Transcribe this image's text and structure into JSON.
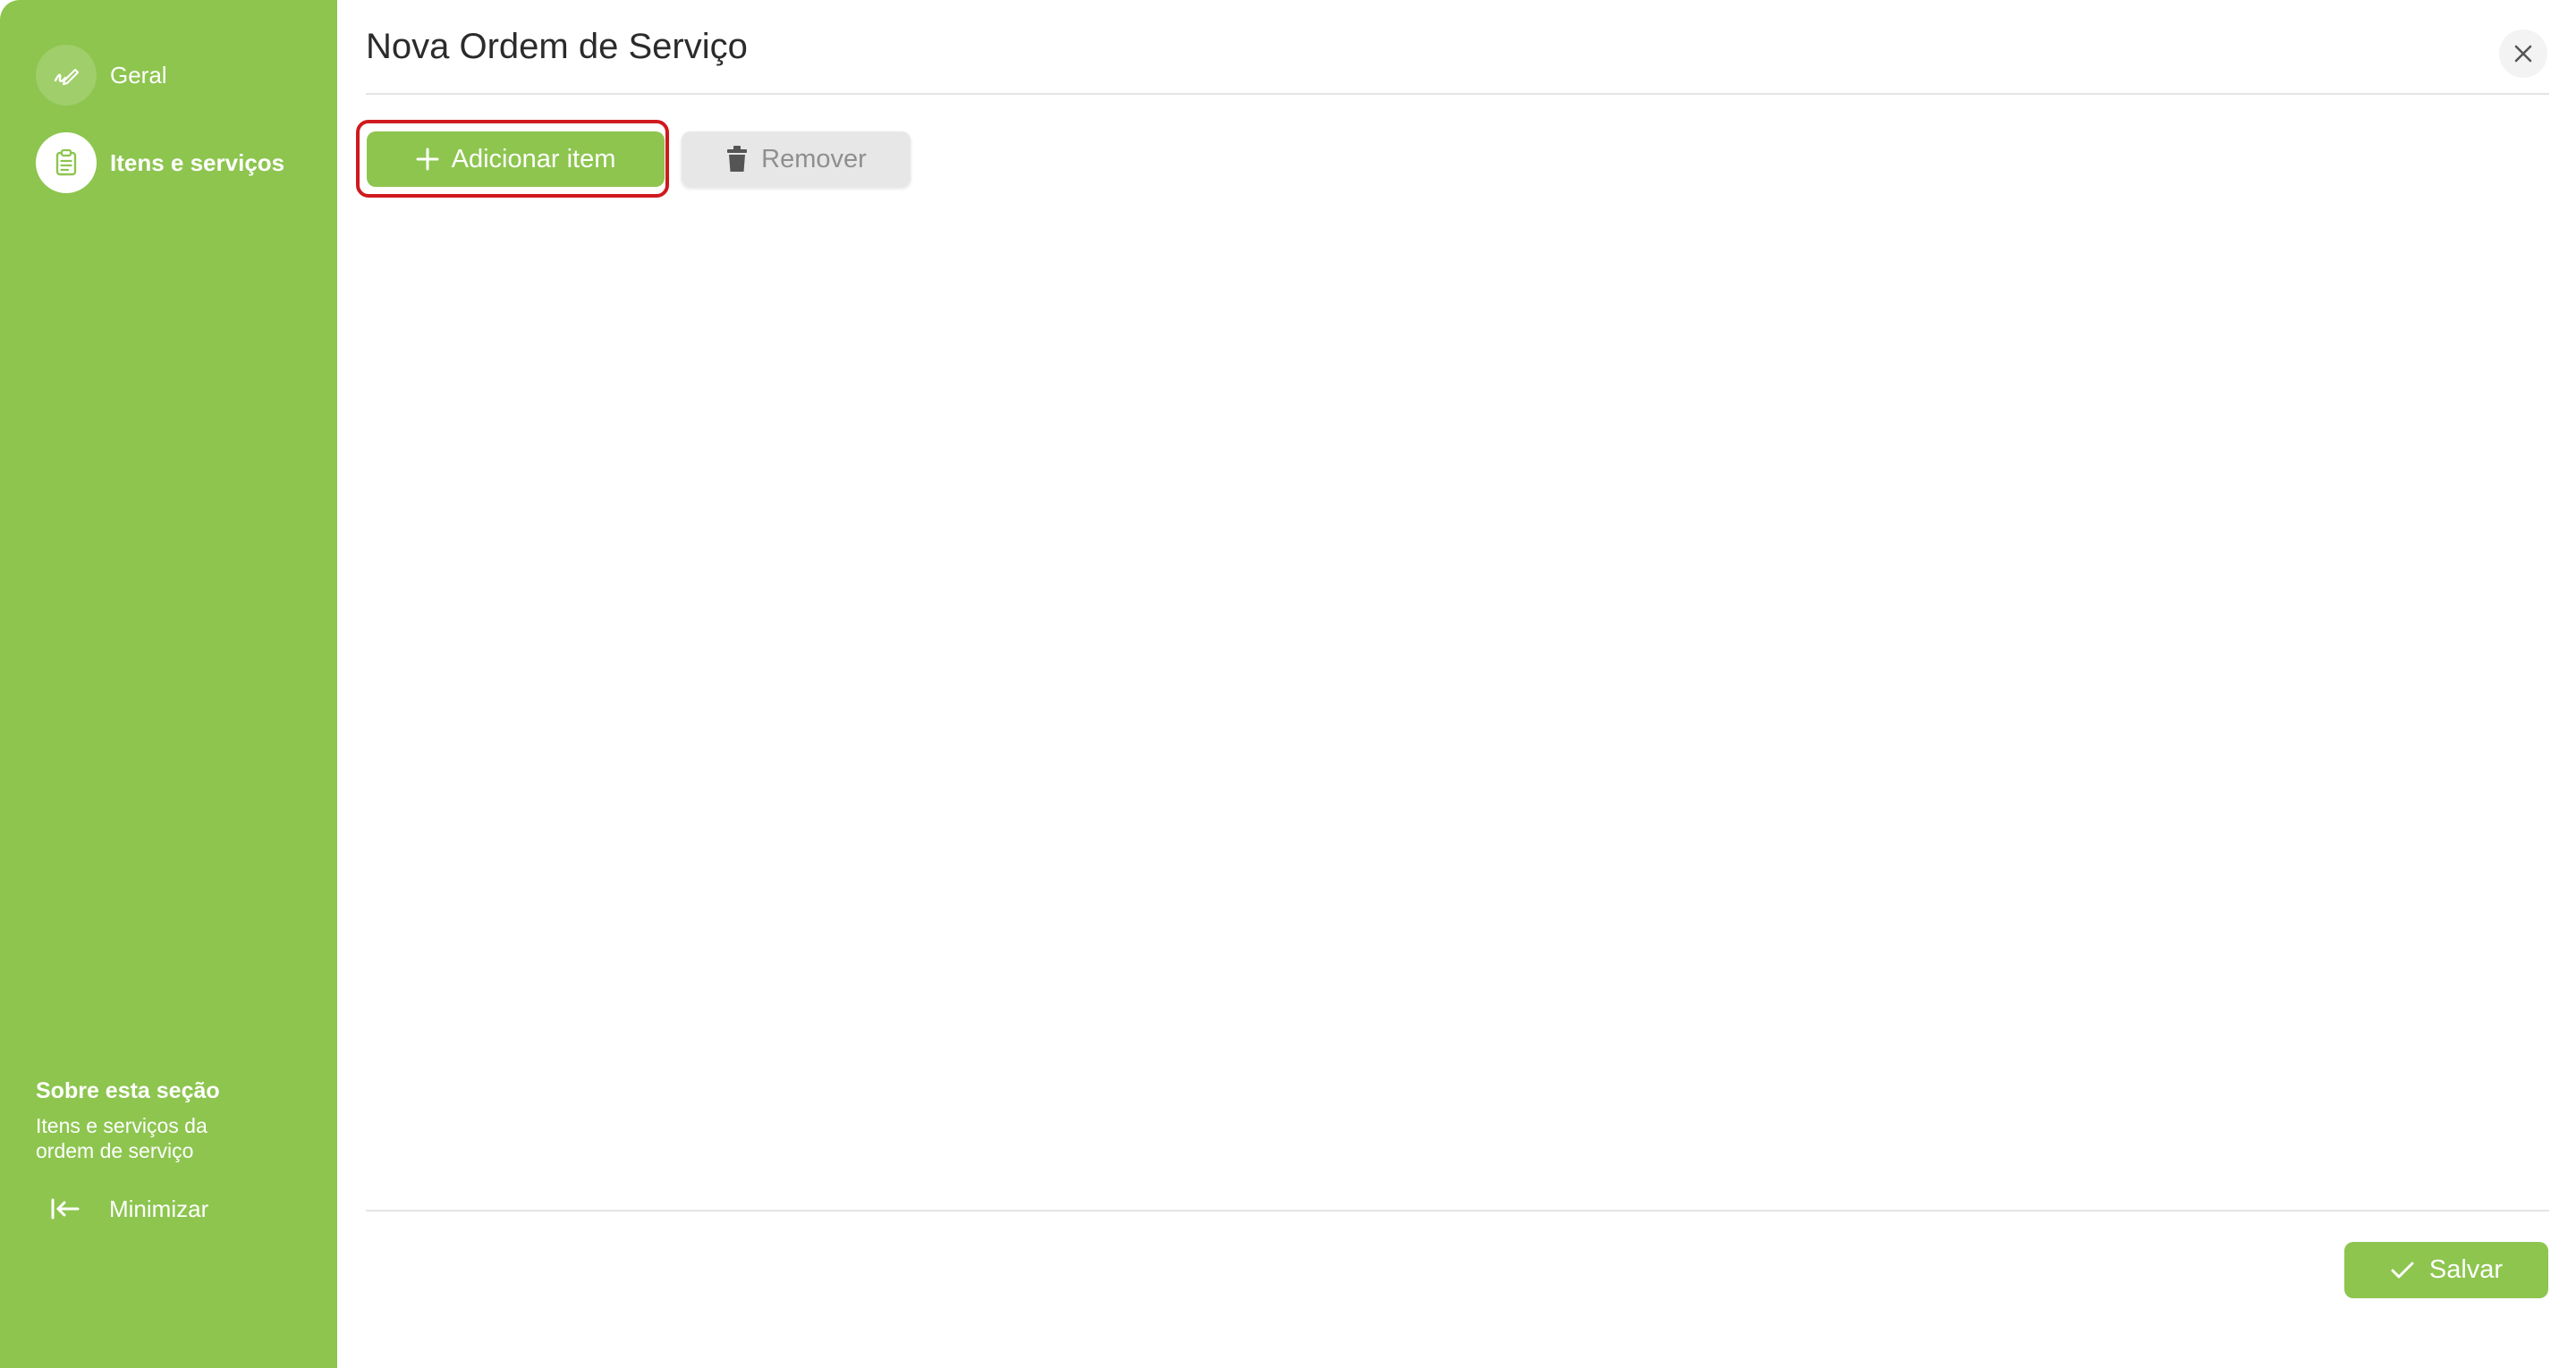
{
  "colors": {
    "accent_green": "#8dc54f",
    "highlight_red": "#d0191f",
    "disabled_gray": "#e7e7e7"
  },
  "sidebar": {
    "items": [
      {
        "label": "Geral",
        "icon": "pencil-signature-icon",
        "active": false
      },
      {
        "label": "Itens e serviços",
        "icon": "clipboard-list-icon",
        "active": true
      }
    ],
    "about": {
      "title": "Sobre esta seção",
      "text": "Itens e serviços da ordem de serviço"
    },
    "minimize_label": "Minimizar",
    "minimize_icon": "arrow-left-to-line-icon"
  },
  "header": {
    "title": "Nova Ordem de Serviço",
    "close_icon": "close-icon"
  },
  "toolbar": {
    "add_label": "Adicionar item",
    "add_icon": "plus-icon",
    "remove_label": "Remover",
    "remove_icon": "trash-icon"
  },
  "footer": {
    "save_label": "Salvar",
    "save_icon": "check-icon"
  }
}
